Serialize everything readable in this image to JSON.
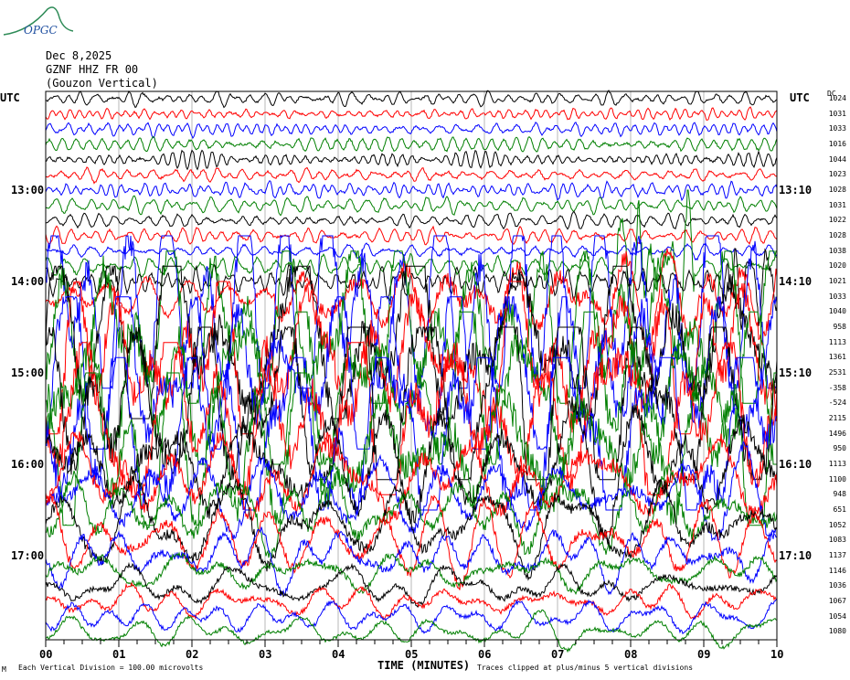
{
  "logo": {
    "text": "OPGC"
  },
  "header": {
    "date": "Dec 8,2025",
    "station": "GZNF HHZ FR 00",
    "name": "(Gouzon Vertical)"
  },
  "axis": {
    "left_unit": "UTC",
    "right_unit": "UTC",
    "dc_label": "DC",
    "xlabel": "TIME (MINUTES)"
  },
  "footer": {
    "mark": "M",
    "scale_note": "Each Vertical Division =  100.00 microvolts",
    "clip_note": "Traces clipped at plus/minus 5 vertical divisions"
  },
  "chart_data": {
    "type": "line",
    "title": "GZNF HHZ FR 00 (Gouzon Vertical) Dec 8,2025",
    "xlabel": "TIME (MINUTES)",
    "x_ticks": [
      "00",
      "01",
      "02",
      "03",
      "04",
      "05",
      "06",
      "07",
      "08",
      "09",
      "10"
    ],
    "xlim": [
      0,
      10
    ],
    "left_labels": [
      {
        "row": 6,
        "text": "13:00"
      },
      {
        "row": 12,
        "text": "14:00"
      },
      {
        "row": 18,
        "text": "15:00"
      },
      {
        "row": 24,
        "text": "16:00"
      },
      {
        "row": 30,
        "text": "17:00"
      }
    ],
    "right_labels": [
      {
        "row": 6,
        "text": "13:10"
      },
      {
        "row": 12,
        "text": "14:10"
      },
      {
        "row": 18,
        "text": "15:10"
      },
      {
        "row": 24,
        "text": "16:10"
      },
      {
        "row": 30,
        "text": "17:10"
      }
    ],
    "trace_colors": [
      "#000000",
      "#ff0000",
      "#0000ff",
      "#007f00"
    ],
    "dc_offsets": [
      "1024",
      "1031",
      "1033",
      "1016",
      "1044",
      "1023",
      "1028",
      "1031",
      "1022",
      "1028",
      "1038",
      "1020",
      "1021",
      "1033",
      "1040",
      "958",
      "1113",
      "1361",
      "2531",
      "-358",
      "-524",
      "2115",
      "1496",
      "950",
      "1113",
      "1100",
      "948",
      "651",
      "1052",
      "1083",
      "1137",
      "1146",
      "1036",
      "1067",
      "1054",
      "1080"
    ],
    "amplitude_divisions": [
      0.3,
      0.3,
      0.3,
      0.35,
      0.35,
      0.35,
      0.35,
      0.3,
      0.3,
      0.35,
      0.35,
      0.5,
      0.6,
      2.5,
      5,
      5,
      5,
      5,
      5,
      5,
      5,
      5,
      5,
      5,
      3,
      2.5,
      2,
      2,
      1.8,
      1.5,
      1.2,
      1,
      0.9,
      0.8,
      0.7,
      0.6
    ],
    "clip_divisions": 5,
    "division_microvolts": 100
  }
}
